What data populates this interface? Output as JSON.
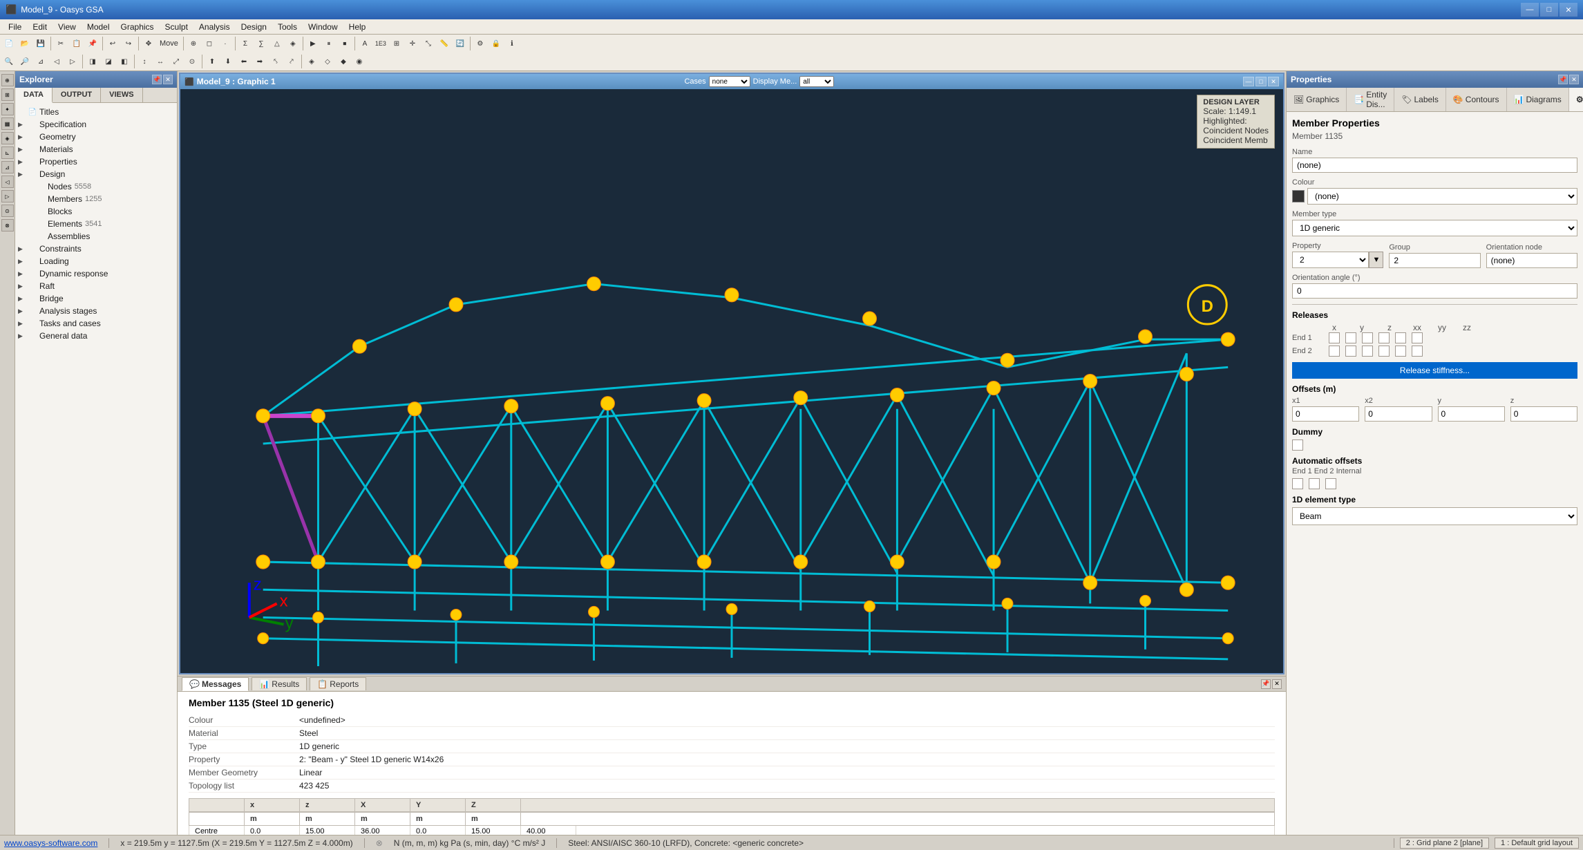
{
  "window": {
    "title": "Model_9 - Oasys GSA",
    "graphic_title": "Model_9 : Graphic 1"
  },
  "title_bar": {
    "minimize": "—",
    "maximize": "□",
    "close": "✕"
  },
  "menu": {
    "items": [
      "File",
      "Edit",
      "View",
      "Model",
      "Graphics",
      "Sculpt",
      "Analysis",
      "Design",
      "Tools",
      "Window",
      "Help"
    ]
  },
  "explorer": {
    "title": "Explorer",
    "tabs": [
      "DATA",
      "OUTPUT",
      "VIEWS"
    ],
    "tree": [
      {
        "label": "Titles",
        "indent": 0,
        "icon": "📄",
        "count": ""
      },
      {
        "label": "Specification",
        "indent": 0,
        "icon": "▶",
        "count": ""
      },
      {
        "label": "Geometry",
        "indent": 0,
        "icon": "▶",
        "count": ""
      },
      {
        "label": "Materials",
        "indent": 0,
        "icon": "▶",
        "count": ""
      },
      {
        "label": "Properties",
        "indent": 0,
        "icon": "▶",
        "count": ""
      },
      {
        "label": "Design",
        "indent": 0,
        "icon": "▶",
        "count": ""
      },
      {
        "label": "Nodes",
        "indent": 1,
        "icon": "",
        "count": "5558"
      },
      {
        "label": "Members",
        "indent": 1,
        "icon": "",
        "count": "1255"
      },
      {
        "label": "Blocks",
        "indent": 1,
        "icon": "",
        "count": ""
      },
      {
        "label": "Elements",
        "indent": 1,
        "icon": "",
        "count": "3541"
      },
      {
        "label": "Assemblies",
        "indent": 1,
        "icon": "",
        "count": ""
      },
      {
        "label": "Constraints",
        "indent": 0,
        "icon": "▶",
        "count": ""
      },
      {
        "label": "Loading",
        "indent": 0,
        "icon": "▶",
        "count": ""
      },
      {
        "label": "Dynamic response",
        "indent": 0,
        "icon": "▶",
        "count": ""
      },
      {
        "label": "Raft",
        "indent": 0,
        "icon": "▶",
        "count": ""
      },
      {
        "label": "Bridge",
        "indent": 0,
        "icon": "▶",
        "count": ""
      },
      {
        "label": "Analysis stages",
        "indent": 0,
        "icon": "▶",
        "count": ""
      },
      {
        "label": "Tasks and cases",
        "indent": 0,
        "icon": "▶",
        "count": ""
      },
      {
        "label": "General data",
        "indent": 0,
        "icon": "▶",
        "count": ""
      }
    ]
  },
  "design_layer": {
    "title": "DESIGN LAYER",
    "scale": "Scale: 1:149.1",
    "highlighted_label": "Highlighted:",
    "item1": "Coincident Nodes",
    "item2": "Coincident Memb"
  },
  "properties": {
    "header": "Properties",
    "tabs": [
      "Graphics",
      "Entity Dis...",
      "Labels",
      "Contours",
      "Diagrams",
      "Properties"
    ],
    "section_title": "Member Properties",
    "member_id": "Member 1135",
    "fields": {
      "name_label": "Name",
      "name_value": "(none)",
      "colour_label": "Colour",
      "colour_value": "(none)",
      "member_type_label": "Member type",
      "member_type_value": "1D generic",
      "property_label": "Property",
      "property_value": "2",
      "group_label": "Group",
      "group_value": "2",
      "orientation_node_label": "Orientation node",
      "orientation_node_value": "(none)",
      "orientation_angle_label": "Orientation angle (°)",
      "orientation_angle_value": "0",
      "releases_label": "Releases",
      "axis_x": "x",
      "axis_y": "y",
      "axis_z": "z",
      "axis_xx": "xx",
      "axis_yy": "yy",
      "axis_zz": "zz",
      "end1_label": "End 1",
      "end2_label": "End 2",
      "release_stiffness_btn": "Release stiffness...",
      "offsets_label": "Offsets (m)",
      "x1_label": "x1",
      "x1_value": "0",
      "x2_label": "x2",
      "x2_value": "0",
      "y_label": "y",
      "y_value": "0",
      "z_label": "z",
      "z_value": "0",
      "dummy_label": "Dummy",
      "auto_offsets_label": "Automatic offsets",
      "end1_end2_label": "End 1 End 2 Internal",
      "element_type_label": "1D element type",
      "element_type_value": "Beam"
    }
  },
  "messages": {
    "header": "Messages",
    "tabs": [
      "Messages",
      "Results",
      "Reports"
    ],
    "member_title": "Member 1135 (Steel 1D generic)",
    "rows": [
      {
        "label": "Colour",
        "value": "<undefined>"
      },
      {
        "label": "Material",
        "value": "Steel"
      },
      {
        "label": "Type",
        "value": "1D generic"
      },
      {
        "label": "Property",
        "value": "2: \"Beam - y\" Steel 1D generic W14x26"
      },
      {
        "label": "Member Geometry",
        "value": "Linear"
      },
      {
        "label": "Topology list",
        "value": "423 425"
      }
    ],
    "table_headers": [
      "",
      "x",
      "z",
      "X",
      "Y",
      "Z"
    ],
    "table_sub": [
      "",
      "m",
      "m",
      "m",
      "m",
      "m"
    ],
    "table_row": [
      "Centre",
      "0.0",
      "15.00",
      "36.00",
      "0.0",
      "15.00",
      "40.00"
    ]
  },
  "status_bar": {
    "website": "www.oasys-software.com",
    "coordinates": "x = 219.5m  y = 1127.5m  (X = 219.5m  Y = 1127.5m  Z = 4.000m)",
    "units": "N (m, m, m)  kg  Pa  (s, min, day)  °C  m/s²  J",
    "steel_info": "Steel: ANSI/AISC 360-10 (LRFD), Concrete: <generic concrete>",
    "grid_plane": "2 : Grid plane 2 [plane]",
    "grid_layout": "1 : Default grid layout"
  }
}
